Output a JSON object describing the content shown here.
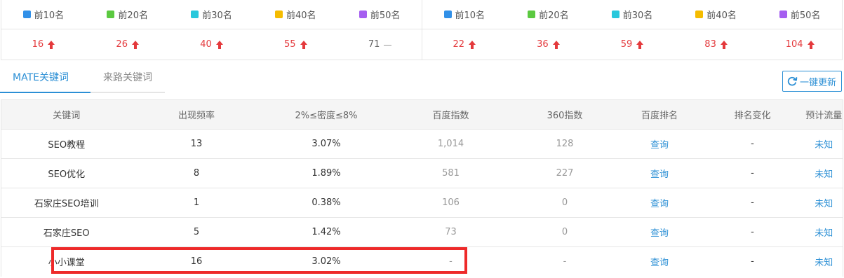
{
  "rank_stats": [
    {
      "legend": [
        {
          "label": "前10名",
          "color": "#3190e8"
        },
        {
          "label": "前20名",
          "color": "#5bc940"
        },
        {
          "label": "前30名",
          "color": "#28c8dc"
        },
        {
          "label": "前40名",
          "color": "#f5bc00"
        },
        {
          "label": "前50名",
          "color": "#a55ef0"
        }
      ],
      "values": [
        {
          "value": "16",
          "trend": "up"
        },
        {
          "value": "26",
          "trend": "up"
        },
        {
          "value": "40",
          "trend": "up"
        },
        {
          "value": "55",
          "trend": "up"
        },
        {
          "value": "71",
          "trend": "flat"
        }
      ]
    },
    {
      "legend": [
        {
          "label": "前10名",
          "color": "#3190e8"
        },
        {
          "label": "前20名",
          "color": "#5bc940"
        },
        {
          "label": "前30名",
          "color": "#28c8dc"
        },
        {
          "label": "前40名",
          "color": "#f5bc00"
        },
        {
          "label": "前50名",
          "color": "#a55ef0"
        }
      ],
      "values": [
        {
          "value": "22",
          "trend": "up"
        },
        {
          "value": "36",
          "trend": "up"
        },
        {
          "value": "59",
          "trend": "up"
        },
        {
          "value": "83",
          "trend": "up"
        },
        {
          "value": "104",
          "trend": "up"
        }
      ]
    }
  ],
  "tabs": [
    {
      "label": "MATE关键词",
      "active": true
    },
    {
      "label": "来路关键词",
      "active": false
    }
  ],
  "refresh_button": {
    "label": "一键更新",
    "icon": "refresh-icon"
  },
  "table": {
    "headers": [
      "关键词",
      "出现频率",
      "2%≤密度≤8%",
      "百度指数",
      "360指数",
      "百度排名",
      "排名变化",
      "预计流量"
    ],
    "rows": [
      [
        "SEO教程",
        "13",
        "3.07%",
        "1,014",
        "128",
        "查询",
        "-",
        "未知"
      ],
      [
        "SEO优化",
        "8",
        "1.89%",
        "581",
        "227",
        "查询",
        "-",
        "未知"
      ],
      [
        "石家庄SEO培训",
        "1",
        "0.38%",
        "106",
        "0",
        "查询",
        "-",
        "未知"
      ],
      [
        "石家庄SEO",
        "5",
        "1.42%",
        "73",
        "0",
        "查询",
        "-",
        "未知"
      ],
      [
        "小小课堂",
        "16",
        "3.02%",
        "-",
        "-",
        "查询",
        "-",
        "未知"
      ]
    ]
  },
  "colors": {
    "accent": "#2b8fd5",
    "up": "#e4393c",
    "highlight": "#ee2a2a"
  }
}
